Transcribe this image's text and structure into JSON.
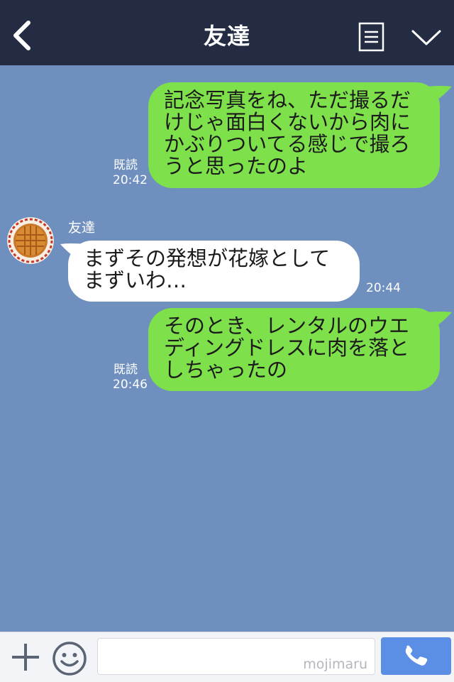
{
  "header": {
    "title": "友達",
    "back_icon": "chevron-left-icon",
    "menu_icon": "note-list-icon",
    "dropdown_icon": "chevron-down-icon"
  },
  "colors": {
    "header_bg": "#232c43",
    "chat_bg": "#6f8fbf",
    "outgoing_bubble": "#7ee14c",
    "incoming_bubble": "#ffffff",
    "call_button": "#5b8ee5"
  },
  "messages": [
    {
      "direction": "outgoing",
      "text": "記念写真をね、ただ撮るだ\nけじゃ面白くないから肉に\nかぶりついてる感じで撮ろ\nうと思ったのよ",
      "read": "既読",
      "time": "20:42"
    },
    {
      "direction": "incoming",
      "sender": "友達",
      "text": "まずその発想が花嫁として\nまずいわ…",
      "time": "20:44"
    },
    {
      "direction": "outgoing",
      "text": "そのとき、レンタルのウエ\nディングドレスに肉を落と\nしちゃったの",
      "read": "既読",
      "time": "20:46"
    }
  ],
  "footer": {
    "plus_icon": "plus-icon",
    "emoji_icon": "smiley-icon",
    "input_value": "",
    "watermark": "mojimaru",
    "call_icon": "phone-icon"
  }
}
